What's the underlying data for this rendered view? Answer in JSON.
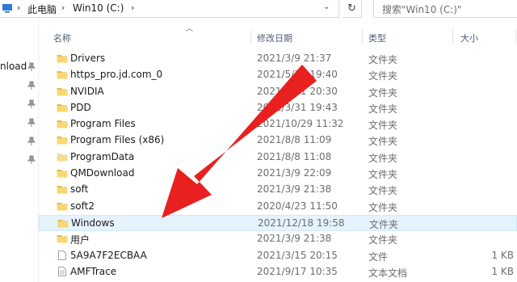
{
  "addressbar": {
    "crumbs": [
      "此电脑",
      "Win10 (C:)"
    ],
    "separator": "›"
  },
  "search": {
    "placeholder": "搜索\"Win10 (C:)\""
  },
  "navpane": {
    "partial_item": "nload"
  },
  "columns": {
    "name": "名称",
    "modified": "修改日期",
    "type": "类型",
    "size": "大小"
  },
  "rows": [
    {
      "name": "Drivers",
      "modified": "2021/3/9 21:37",
      "type": "文件夹",
      "size": "",
      "icon": "folder-icon"
    },
    {
      "name": "https_pro.jd.com_0",
      "modified": "2021/5/31 19:40",
      "type": "文件夹",
      "size": "",
      "icon": "folder-icon"
    },
    {
      "name": "NVIDIA",
      "modified": "2021/3/31 20:30",
      "type": "文件夹",
      "size": "",
      "icon": "folder-icon"
    },
    {
      "name": "PDD",
      "modified": "2021/3/31 19:43",
      "type": "文件夹",
      "size": "",
      "icon": "folder-icon"
    },
    {
      "name": "Program Files",
      "modified": "2021/10/29 11:32",
      "type": "文件夹",
      "size": "",
      "icon": "folder-icon"
    },
    {
      "name": "Program Files (x86)",
      "modified": "2021/8/8 11:09",
      "type": "文件夹",
      "size": "",
      "icon": "folder-icon"
    },
    {
      "name": "ProgramData",
      "modified": "2021/8/8 11:08",
      "type": "文件夹",
      "size": "",
      "icon": "hidden-folder-icon"
    },
    {
      "name": "QMDownload",
      "modified": "2021/3/9 22:09",
      "type": "文件夹",
      "size": "",
      "icon": "folder-icon"
    },
    {
      "name": "soft",
      "modified": "2021/3/9 21:38",
      "type": "文件夹",
      "size": "",
      "icon": "folder-icon"
    },
    {
      "name": "soft2",
      "modified": "2020/4/23 11:50",
      "type": "文件夹",
      "size": "",
      "icon": "folder-icon"
    },
    {
      "name": "Windows",
      "modified": "2021/12/18 19:58",
      "type": "文件夹",
      "size": "",
      "icon": "folder-icon",
      "selected": true
    },
    {
      "name": "用户",
      "modified": "2021/3/9 21:38",
      "type": "文件夹",
      "size": "",
      "icon": "folder-icon"
    },
    {
      "name": "5A9A7F2ECBAA",
      "modified": "2021/3/15 20:15",
      "type": "文件",
      "size": "1 KB",
      "icon": "file-icon"
    },
    {
      "name": "AMFTrace",
      "modified": "2021/9/17 10:35",
      "type": "文本文档",
      "size": "1 KB",
      "icon": "text-file-icon"
    }
  ],
  "colors": {
    "folder": "#f8d775",
    "folder_dark": "#e8b84a",
    "selection": "#e5f3ff",
    "arrow": "#e8201f"
  }
}
